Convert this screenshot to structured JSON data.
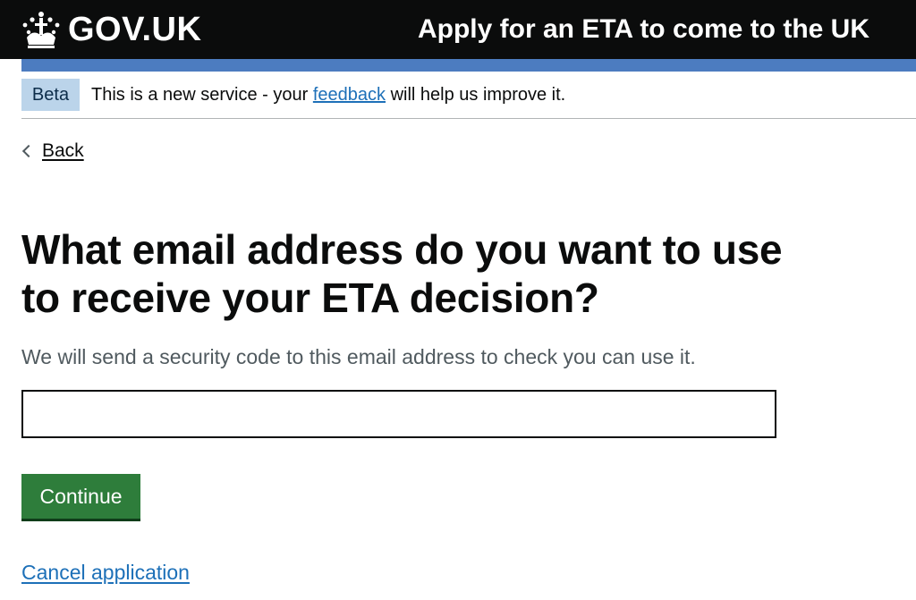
{
  "header": {
    "logo_text": "GOV.UK",
    "logo_icon": "crown-icon",
    "service_name": "Apply for an ETA to come to the UK",
    "background_color": "#0b0c0c",
    "accent_color": "#4c7cc0"
  },
  "phase_banner": {
    "tag": "Beta",
    "text_before": "This is a new service - your ",
    "link_text": "feedback",
    "text_after": " will help us improve it."
  },
  "back_link": {
    "icon": "chevron-left-icon",
    "label": "Back"
  },
  "main": {
    "heading": "What email address do you want to use to receive your ETA decision?",
    "hint": "We will send a security code to this email address to check you can use it.",
    "email_input": {
      "value": "",
      "placeholder": ""
    },
    "continue_label": "Continue",
    "continue_color": "#2e7d3b",
    "cancel_label": "Cancel application",
    "link_color": "#1d70b8"
  }
}
